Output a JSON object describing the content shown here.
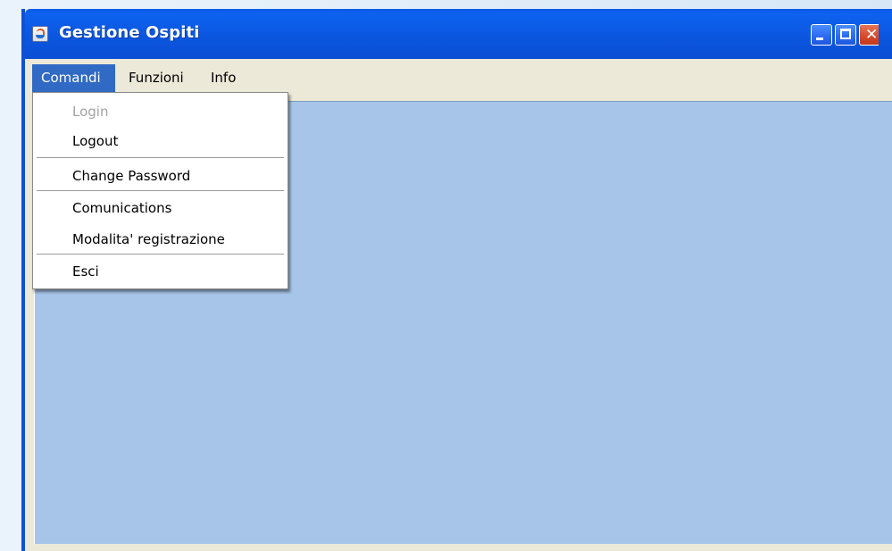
{
  "window": {
    "title": "Gestione Ospiti",
    "icon": "java-coffee-cup-icon",
    "controls": {
      "minimize_icon": "minimize-icon",
      "maximize_icon": "maximize-icon",
      "close_icon": "close-icon",
      "close_glyph": "✕"
    }
  },
  "menubar": {
    "items": [
      {
        "label": "Comandi",
        "active": true
      },
      {
        "label": "Funzioni",
        "active": false
      },
      {
        "label": "Info",
        "active": false
      }
    ]
  },
  "dropdown": {
    "parent": "Comandi",
    "items": [
      {
        "label": "Login",
        "enabled": false
      },
      {
        "label": "Logout",
        "enabled": true
      },
      {
        "label": "Change Password",
        "enabled": true
      },
      {
        "label": "Comunications",
        "enabled": true
      },
      {
        "label": "Modalita' registrazione",
        "enabled": true
      },
      {
        "label": "Esci",
        "enabled": true
      }
    ]
  },
  "colors": {
    "titlebar": "#0b55de",
    "menu_highlight": "#316ac5",
    "content_background": "#a6c5e8",
    "menubar_background": "#ece9d8",
    "disabled_text": "#a3a3a3"
  }
}
